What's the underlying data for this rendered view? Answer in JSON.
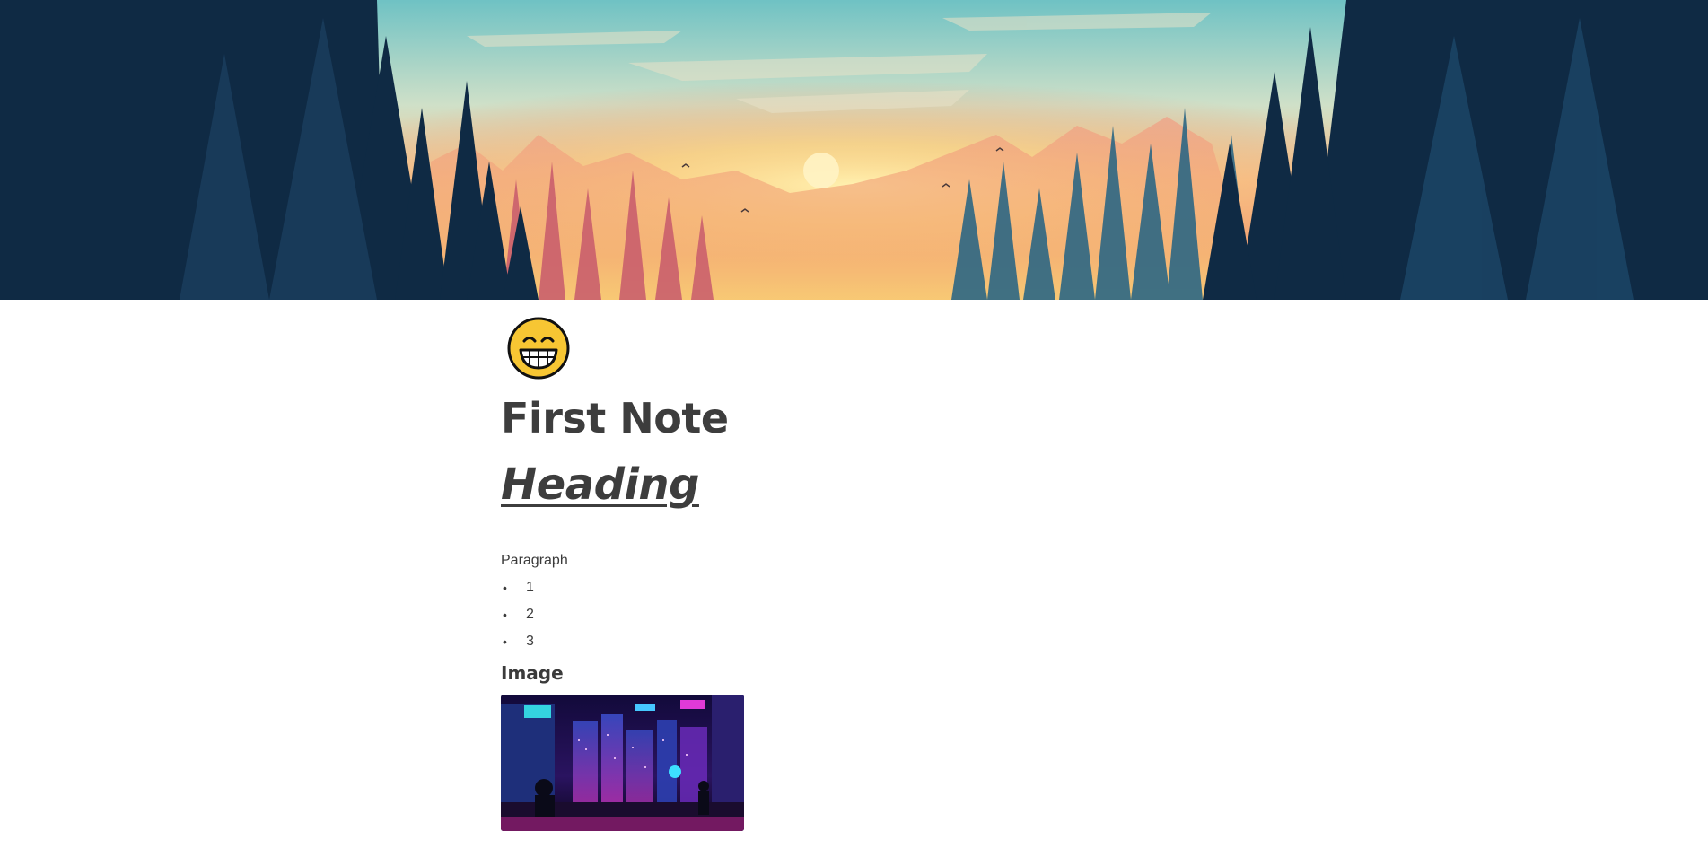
{
  "cover": {
    "description_icon": "forest-sunset-cover-image",
    "colors": {
      "sky_top": "#7cc6c9",
      "sky_mid": "#f6c98f",
      "sun": "#fbe9a8",
      "glow": "#f08a6a",
      "forest_dark": "#0d2540",
      "forest_mid": "#1e4a6b"
    }
  },
  "page": {
    "icon": "grinning-face-icon",
    "title": "First Note"
  },
  "blocks": {
    "heading": "Heading",
    "paragraph": "Paragraph",
    "bullets": [
      {
        "marker": "•",
        "text": "1"
      },
      {
        "marker": "•",
        "text": "2"
      },
      {
        "marker": "•",
        "text": "3"
      }
    ],
    "subheading": "Image",
    "image_icon": "cyberpunk-city-image"
  }
}
